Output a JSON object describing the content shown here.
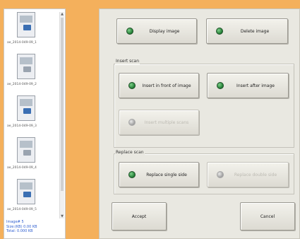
{
  "sidebar": {
    "thumbnails": [
      {
        "label": "ae_2014-049-09_1",
        "icon": "image-scan-icon"
      },
      {
        "label": "ae_2014-049-09_2",
        "icon": "image-scan-icon"
      },
      {
        "label": "ae_2014-049-09_3",
        "icon": "image-scan-icon"
      },
      {
        "label": "ae_2014-049-09_4",
        "icon": "image-scan-icon"
      },
      {
        "label": "ae_2014-049-09_5",
        "icon": "image-scan-icon"
      }
    ],
    "info": {
      "line1": "Image# 5",
      "line2": "Size:(KB) 0.00 KB",
      "line3": "Total: 0.000 KB"
    }
  },
  "buttons": {
    "display_image": "Display image",
    "delete_image": "Delete image",
    "insert_front": "Insert in front of image",
    "insert_after": "Insert after image",
    "insert_multiple": "Insert multiple scans",
    "replace_single": "Replace single side",
    "replace_double": "Replace double side",
    "accept": "Accept",
    "cancel": "Cancel"
  },
  "groups": {
    "insert_title": "Insert scan",
    "replace_title": "Replace scan"
  },
  "colors": {
    "background": "#f4b05c",
    "panel": "#e9e8e1",
    "led_active": "#2e8b3e",
    "led_disabled": "#a8a8a8",
    "info_text": "#2f5fd0"
  }
}
